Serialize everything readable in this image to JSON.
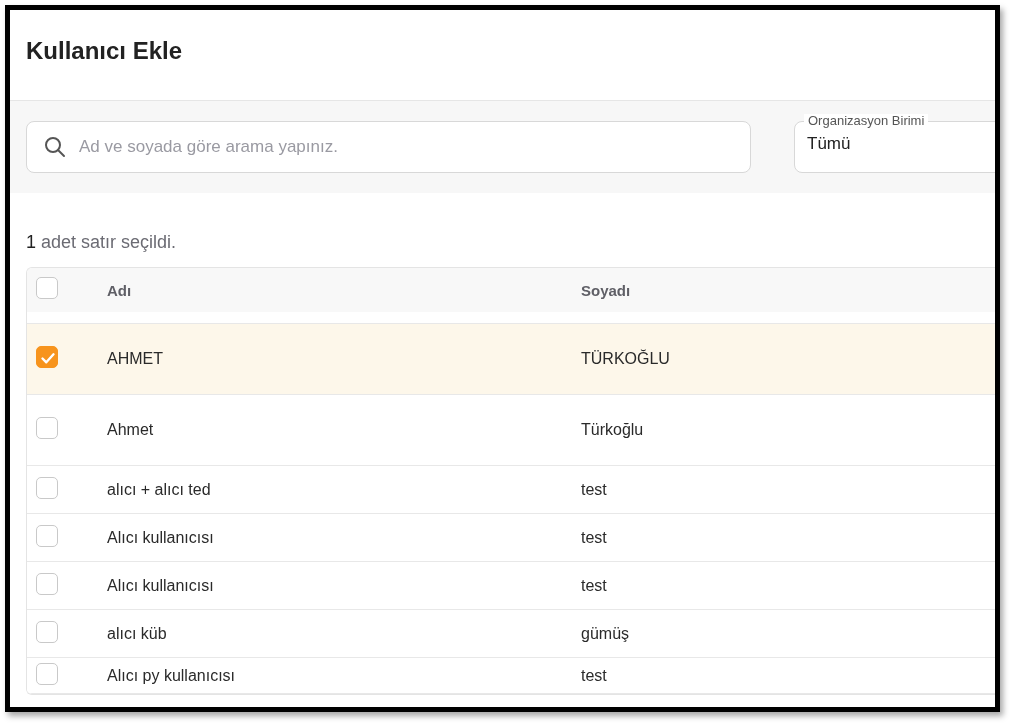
{
  "page": {
    "title": "Kullanıcı Ekle"
  },
  "filters": {
    "search": {
      "placeholder": "Ad ve soyada göre arama yapınız."
    },
    "organization_unit": {
      "label": "Organizasyon Birimi",
      "value": "Tümü"
    }
  },
  "selection": {
    "count": "1",
    "label": "adet satır seçildi."
  },
  "table": {
    "header_checkbox": {
      "checked": false
    },
    "columns": [
      "Adı",
      "Soyadı"
    ],
    "rows": [
      {
        "selected": true,
        "cells": [
          "AHMET",
          "TÜRKOĞLU"
        ]
      },
      {
        "selected": false,
        "cells": [
          "Ahmet",
          "Türkoğlu"
        ]
      },
      {
        "selected": false,
        "cells": [
          "alıcı + alıcı ted",
          "test"
        ]
      },
      {
        "selected": false,
        "cells": [
          "Alıcı kullanıcısı",
          "test"
        ]
      },
      {
        "selected": false,
        "cells": [
          "Alıcı kullanıcısı",
          "test"
        ]
      },
      {
        "selected": false,
        "cells": [
          "alıcı küb",
          "gümüş"
        ]
      },
      {
        "selected": false,
        "cells": [
          "Alıcı py kullanıcısı",
          "test"
        ]
      }
    ]
  }
}
